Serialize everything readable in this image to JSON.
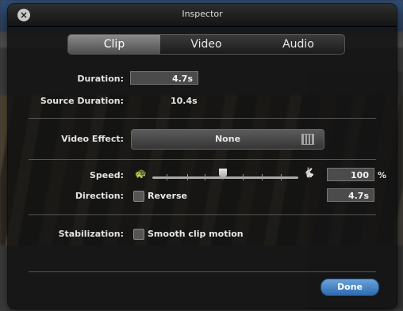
{
  "window": {
    "title": "Inspector"
  },
  "tabs": [
    {
      "label": "Clip",
      "active": true
    },
    {
      "label": "Video",
      "active": false
    },
    {
      "label": "Audio",
      "active": false
    }
  ],
  "clip": {
    "duration_label": "Duration:",
    "duration_value": "4.7s",
    "source_duration_label": "Source Duration:",
    "source_duration_value": "10.4s",
    "video_effect_label": "Video Effect:",
    "video_effect_value": "None",
    "speed_label": "Speed:",
    "speed_value": "100",
    "speed_unit": "%",
    "speed_slider_level": 0.5,
    "direction_label": "Direction:",
    "reverse_label": "Reverse",
    "reverse_checked": false,
    "direction_duration": "4.7s",
    "stabilization_label": "Stabilization:",
    "smooth_label": "Smooth clip motion",
    "smooth_checked": false
  },
  "footer": {
    "done_label": "Done"
  },
  "colors": {
    "accent": "#3a7cc6",
    "panel": "#121212"
  }
}
